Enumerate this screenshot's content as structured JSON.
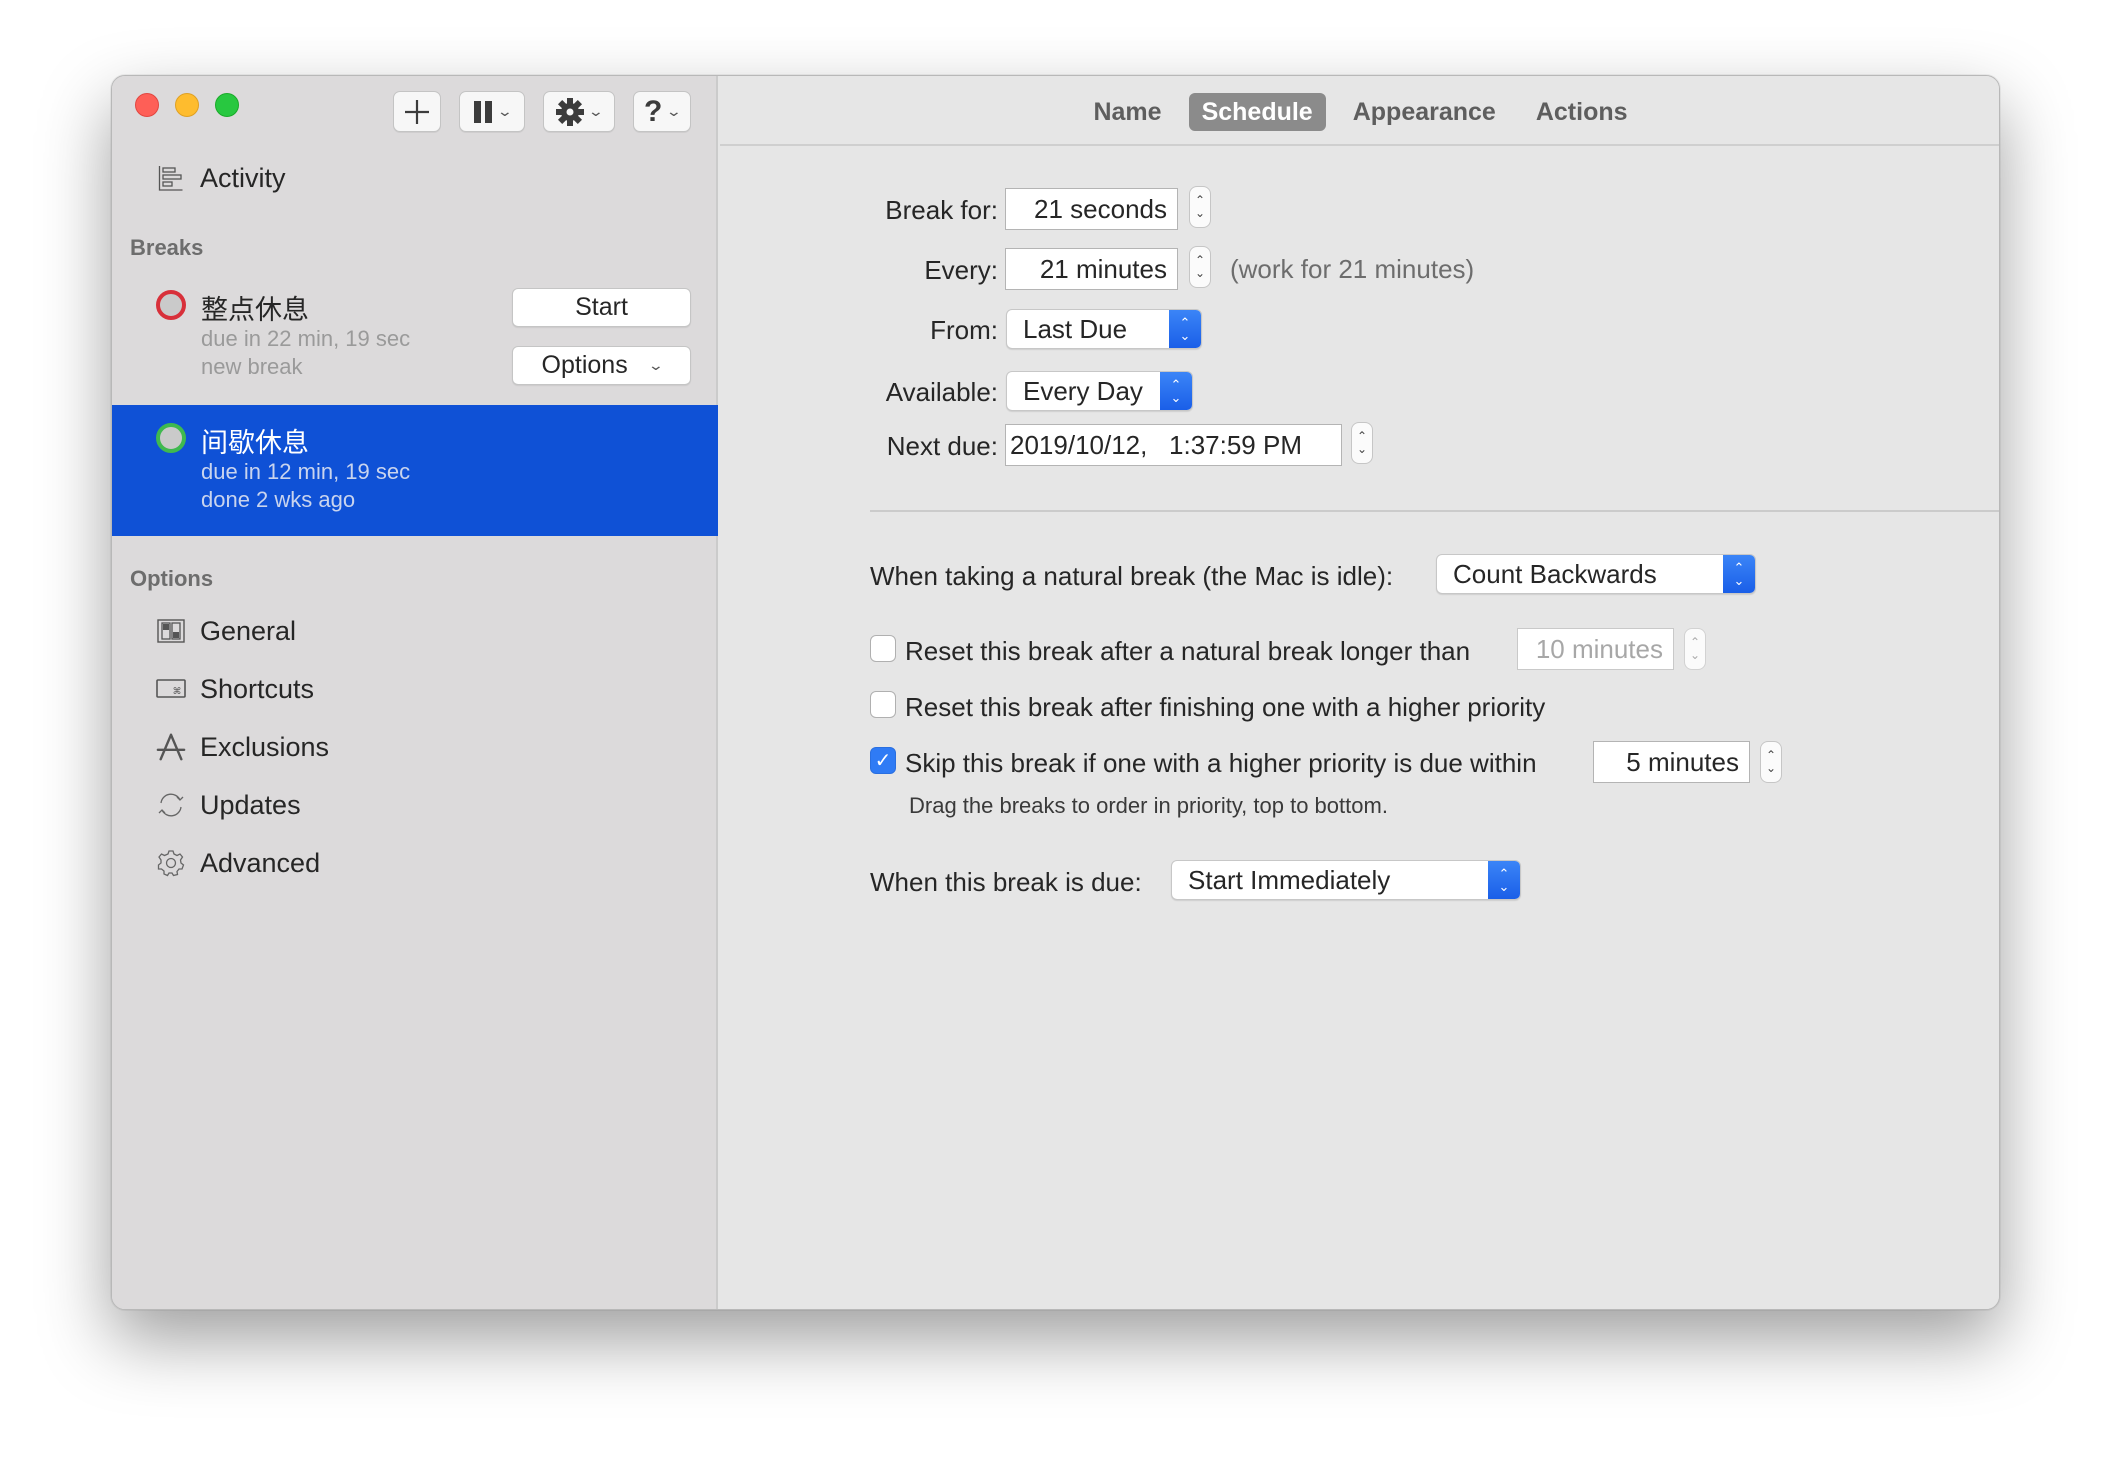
{
  "window": {
    "traffic_lights": [
      "close",
      "minimize",
      "maximize"
    ]
  },
  "toolbar": {
    "add_icon": "plus-icon",
    "pause_icon": "pause-icon",
    "gear_icon": "gear-icon",
    "help_icon": "question-icon",
    "chevron": "⌄"
  },
  "sidebar": {
    "activity": {
      "label": "Activity",
      "icon": "activity-icon"
    },
    "breaks_header": "Breaks",
    "breaks": [
      {
        "name": "整点休息",
        "due": "due in 22 min, 19 sec",
        "status": "new break",
        "ring_color": "#d8303a",
        "selected": false,
        "start_label": "Start",
        "options_label": "Options"
      },
      {
        "name": "间歇休息",
        "due": "due in 12 min, 19 sec",
        "status": "done 2 wks ago",
        "ring_color": "#3fb94f",
        "selected": true
      }
    ],
    "options_header": "Options",
    "options": [
      {
        "label": "General",
        "icon": "general-icon"
      },
      {
        "label": "Shortcuts",
        "icon": "keyboard-icon"
      },
      {
        "label": "Exclusions",
        "icon": "app-store-icon"
      },
      {
        "label": "Updates",
        "icon": "refresh-icon"
      },
      {
        "label": "Advanced",
        "icon": "gear-outline-icon"
      }
    ],
    "selected_color": "#0f51d6"
  },
  "tabs": [
    {
      "label": "Name",
      "active": false
    },
    {
      "label": "Schedule",
      "active": true
    },
    {
      "label": "Appearance",
      "active": false
    },
    {
      "label": "Actions",
      "active": false
    }
  ],
  "schedule": {
    "break_for_label": "Break for:",
    "break_for_value": "21 seconds",
    "every_label": "Every:",
    "every_value": "21 minutes",
    "every_note": "(work for 21 minutes)",
    "from_label": "From:",
    "from_value": "Last Due",
    "available_label": "Available:",
    "available_value": "Every Day",
    "next_due_label": "Next due:",
    "next_due_value": "2019/10/12,   1:37:59 PM",
    "natural_break_label": "When taking a natural break (the Mac is idle):",
    "natural_break_value": "Count Backwards",
    "reset_natural_label": "Reset this break after a natural break longer than",
    "reset_natural_checked": false,
    "reset_natural_value": "10 minutes",
    "reset_priority_label": "Reset this break after finishing one with a higher priority",
    "reset_priority_checked": false,
    "skip_label": "Skip this break if one with a higher priority is due within",
    "skip_checked": true,
    "skip_value": "5 minutes",
    "priority_hint": "Drag the breaks to order in priority, top to bottom.",
    "when_due_label": "When this break is due:",
    "when_due_value": "Start Immediately"
  },
  "colors": {
    "accent": "#2f7bf5",
    "popup_arrow": "#1a5fe8"
  }
}
